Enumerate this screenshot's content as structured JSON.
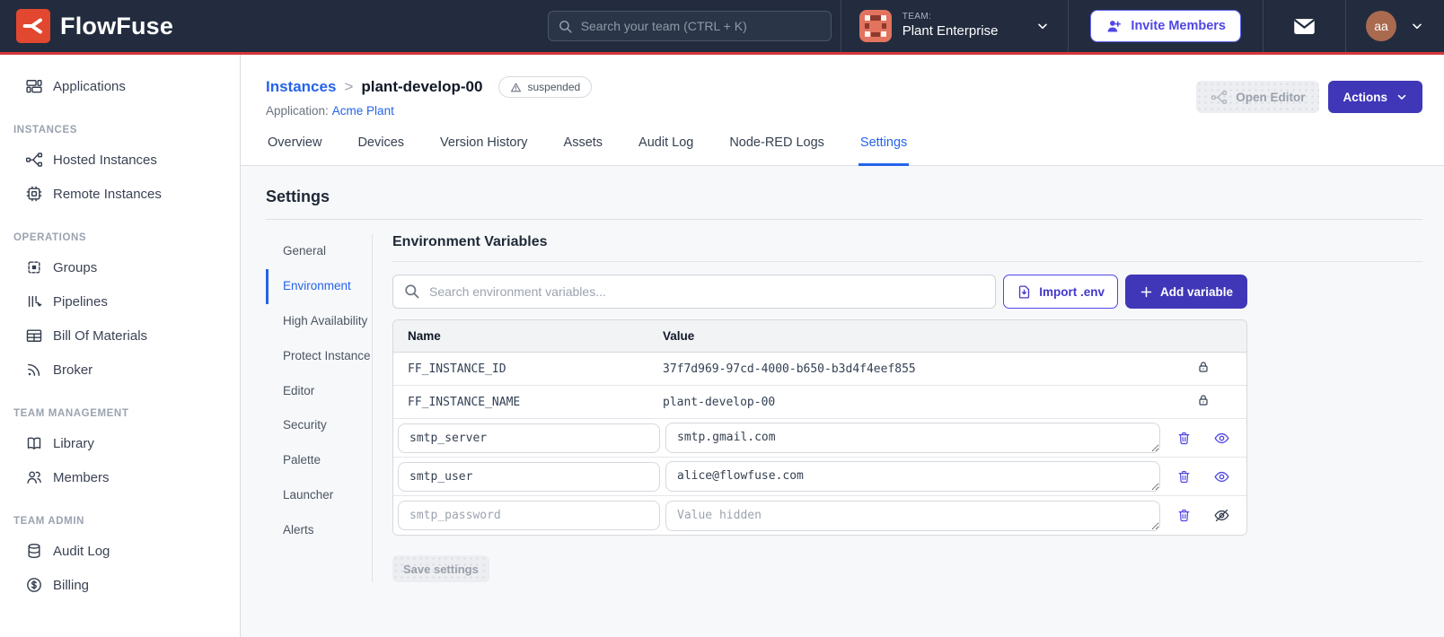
{
  "colors": {
    "navbar_bg": "#222c3e",
    "accent_red": "#d5363c",
    "brand_red": "#e2472f",
    "primary_indigo": "#3f37b8",
    "indigo_icon": "#4f46e5",
    "link_blue": "#2563eb"
  },
  "navbar": {
    "brand": "FlowFuse",
    "search_placeholder": "Search your team (CTRL + K)",
    "team_label": "TEAM:",
    "team_name": "Plant Enterprise",
    "invite_button": "Invite Members",
    "avatar_initials": "aa"
  },
  "sidebar": {
    "sections": [
      {
        "label": "",
        "items": [
          {
            "label": "Applications",
            "icon": "applications-icon"
          }
        ]
      },
      {
        "label": "INSTANCES",
        "items": [
          {
            "label": "Hosted Instances",
            "icon": "hosted-instances-icon"
          },
          {
            "label": "Remote Instances",
            "icon": "remote-instances-icon"
          }
        ]
      },
      {
        "label": "OPERATIONS",
        "items": [
          {
            "label": "Groups",
            "icon": "groups-icon"
          },
          {
            "label": "Pipelines",
            "icon": "pipelines-icon"
          },
          {
            "label": "Bill Of Materials",
            "icon": "bill-of-materials-icon"
          },
          {
            "label": "Broker",
            "icon": "broker-icon"
          }
        ]
      },
      {
        "label": "TEAM MANAGEMENT",
        "items": [
          {
            "label": "Library",
            "icon": "library-icon"
          },
          {
            "label": "Members",
            "icon": "members-icon"
          }
        ]
      },
      {
        "label": "TEAM ADMIN",
        "items": [
          {
            "label": "Audit Log",
            "icon": "audit-log-icon"
          },
          {
            "label": "Billing",
            "icon": "billing-icon"
          }
        ]
      }
    ]
  },
  "header": {
    "breadcrumb_parent": "Instances",
    "breadcrumb_separator": ">",
    "breadcrumb_current": "plant-develop-00",
    "status_badge": "suspended",
    "application_label": "Application:",
    "application_name": "Acme Plant",
    "open_editor_button": "Open Editor",
    "actions_button": "Actions"
  },
  "tabs": [
    {
      "label": "Overview",
      "active": false
    },
    {
      "label": "Devices",
      "active": false
    },
    {
      "label": "Version History",
      "active": false
    },
    {
      "label": "Assets",
      "active": false
    },
    {
      "label": "Audit Log",
      "active": false
    },
    {
      "label": "Node-RED Logs",
      "active": false
    },
    {
      "label": "Settings",
      "active": true
    }
  ],
  "settings": {
    "title": "Settings",
    "nav": [
      {
        "label": "General",
        "active": false
      },
      {
        "label": "Environment",
        "active": true
      },
      {
        "label": "High Availability",
        "active": false
      },
      {
        "label": "Protect Instance",
        "active": false
      },
      {
        "label": "Editor",
        "active": false
      },
      {
        "label": "Security",
        "active": false
      },
      {
        "label": "Palette",
        "active": false
      },
      {
        "label": "Launcher",
        "active": false
      },
      {
        "label": "Alerts",
        "active": false
      }
    ],
    "section_title": "Environment Variables",
    "search_placeholder": "Search environment variables...",
    "import_button": "Import .env",
    "add_button": "Add variable",
    "table": {
      "columns": [
        "Name",
        "Value"
      ],
      "locked_rows": [
        {
          "name": "FF_INSTANCE_ID",
          "value": "37f7d969-97cd-4000-b650-b3d4f4eef855"
        },
        {
          "name": "FF_INSTANCE_NAME",
          "value": "plant-develop-00"
        }
      ],
      "editable_rows": [
        {
          "name": "smtp_server",
          "value": "smtp.gmail.com",
          "value_placeholder": "",
          "hidden": false
        },
        {
          "name": "smtp_user",
          "value": "alice@flowfuse.com",
          "value_placeholder": "",
          "hidden": false
        },
        {
          "name": "smtp_password",
          "value": "",
          "value_placeholder": "Value hidden",
          "hidden": true
        }
      ]
    },
    "save_button": "Save settings"
  }
}
